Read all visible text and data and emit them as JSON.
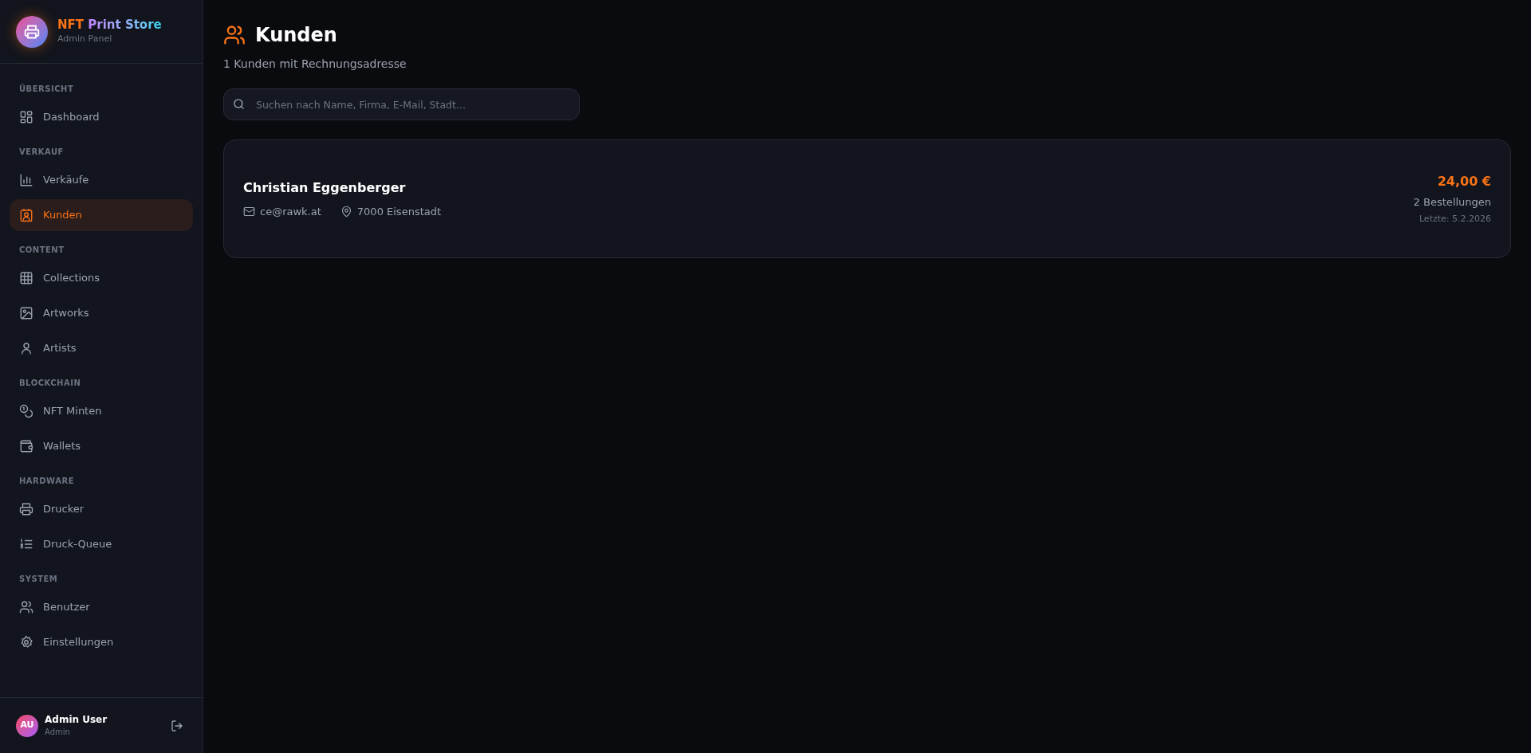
{
  "brand": {
    "title_parts": [
      "NFT",
      "Print Store"
    ],
    "subtitle": "Admin Panel"
  },
  "sidebar": {
    "sections": [
      {
        "label": "ÜBERSICHT",
        "items": [
          {
            "label": "Dashboard",
            "selected": false
          }
        ]
      },
      {
        "label": "VERKAUF",
        "items": [
          {
            "label": "Verkäufe",
            "selected": false
          },
          {
            "label": "Kunden",
            "selected": true
          }
        ]
      },
      {
        "label": "CONTENT",
        "items": [
          {
            "label": "Collections",
            "selected": false
          },
          {
            "label": "Artworks",
            "selected": false
          },
          {
            "label": "Artists",
            "selected": false
          }
        ]
      },
      {
        "label": "BLOCKCHAIN",
        "items": [
          {
            "label": "NFT Minten",
            "selected": false
          },
          {
            "label": "Wallets",
            "selected": false
          }
        ]
      },
      {
        "label": "HARDWARE",
        "items": [
          {
            "label": "Drucker",
            "selected": false
          },
          {
            "label": "Druck-Queue",
            "selected": false
          }
        ]
      },
      {
        "label": "SYSTEM",
        "items": [
          {
            "label": "Benutzer",
            "selected": false
          },
          {
            "label": "Einstellungen",
            "selected": false
          }
        ]
      }
    ]
  },
  "user": {
    "initials": "AU",
    "name": "Admin User",
    "role": "Admin"
  },
  "page": {
    "title": "Kunden",
    "subtitle": "1 Kunden mit Rechnungsadresse"
  },
  "search": {
    "placeholder": "Suchen nach Name, Firma, E-Mail, Stadt..."
  },
  "customers": [
    {
      "name": "Christian Eggenberger",
      "email": "ce@rawk.at",
      "city": "7000 Eisenstadt",
      "total": "24,00 €",
      "orders": "2 Bestellungen",
      "last": "Letzte: 5.2.2026"
    }
  ]
}
